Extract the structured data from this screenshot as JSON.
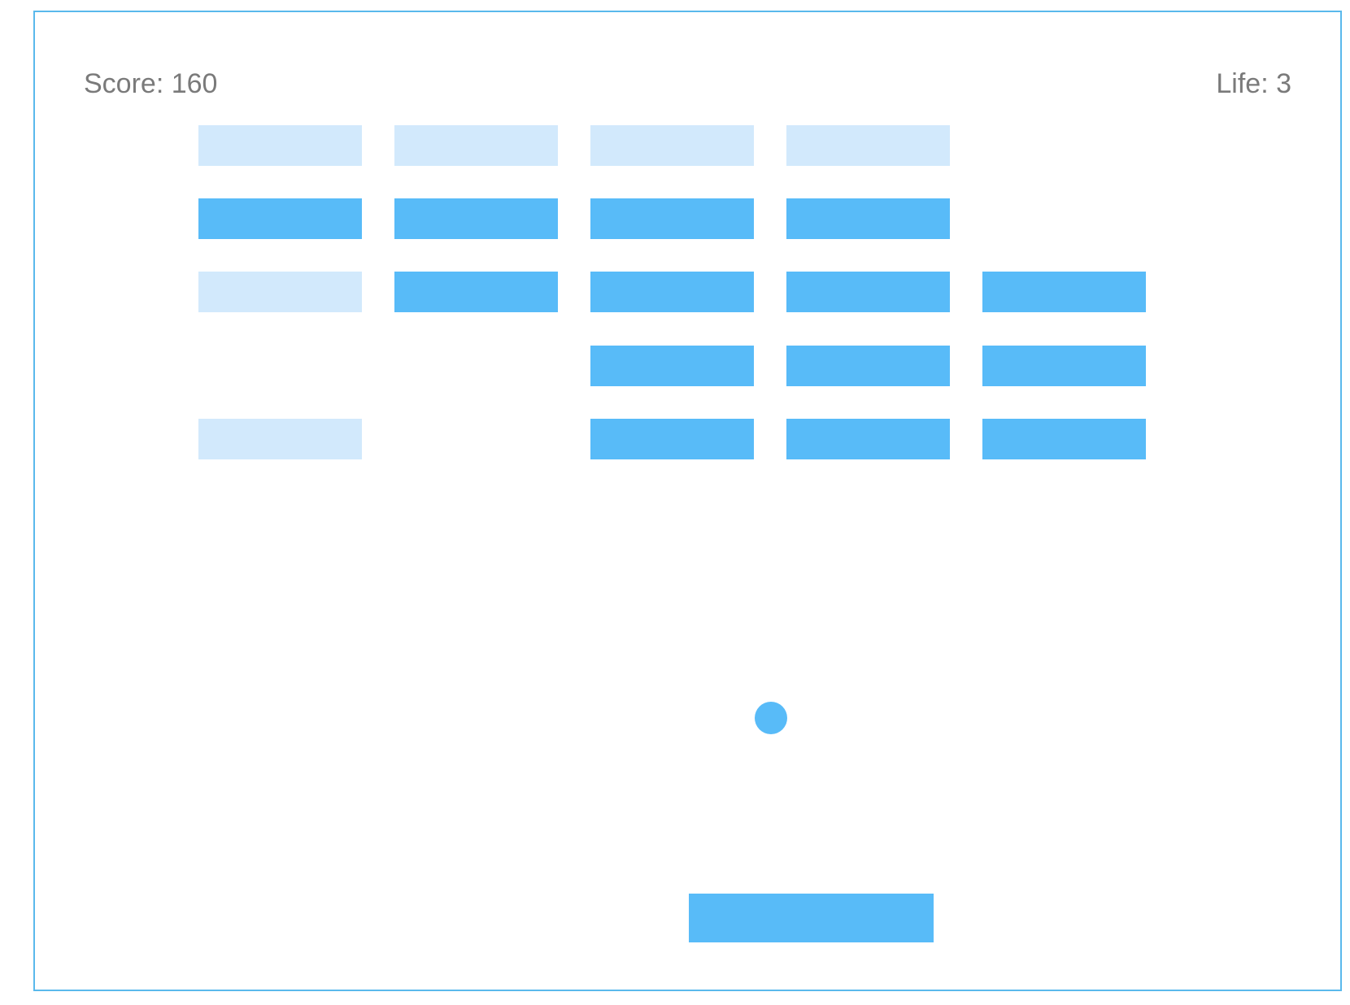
{
  "hud": {
    "score_text": "Score: 160",
    "life_text": "Life: 3"
  },
  "colors": {
    "frame_border": "#5ab9ec",
    "brick_solid": "#58bbf8",
    "brick_faded": "#d2e9fc",
    "ball": "#58bbf8",
    "paddle": "#58bbf8",
    "hud_text": "#7a7a7a"
  },
  "bricks": [
    {
      "row": 1,
      "col": 1,
      "state": "faded"
    },
    {
      "row": 1,
      "col": 2,
      "state": "faded"
    },
    {
      "row": 1,
      "col": 3,
      "state": "faded"
    },
    {
      "row": 1,
      "col": 4,
      "state": "faded"
    },
    {
      "row": 2,
      "col": 1,
      "state": "solid"
    },
    {
      "row": 2,
      "col": 2,
      "state": "solid"
    },
    {
      "row": 2,
      "col": 3,
      "state": "solid"
    },
    {
      "row": 2,
      "col": 4,
      "state": "solid"
    },
    {
      "row": 3,
      "col": 1,
      "state": "faded"
    },
    {
      "row": 3,
      "col": 2,
      "state": "solid"
    },
    {
      "row": 3,
      "col": 3,
      "state": "solid"
    },
    {
      "row": 3,
      "col": 4,
      "state": "solid"
    },
    {
      "row": 3,
      "col": 5,
      "state": "solid"
    },
    {
      "row": 4,
      "col": 3,
      "state": "solid"
    },
    {
      "row": 4,
      "col": 4,
      "state": "solid"
    },
    {
      "row": 4,
      "col": 5,
      "state": "solid"
    },
    {
      "row": 5,
      "col": 1,
      "state": "faded"
    },
    {
      "row": 5,
      "col": 3,
      "state": "solid"
    },
    {
      "row": 5,
      "col": 4,
      "state": "solid"
    },
    {
      "row": 5,
      "col": 5,
      "state": "solid"
    }
  ]
}
